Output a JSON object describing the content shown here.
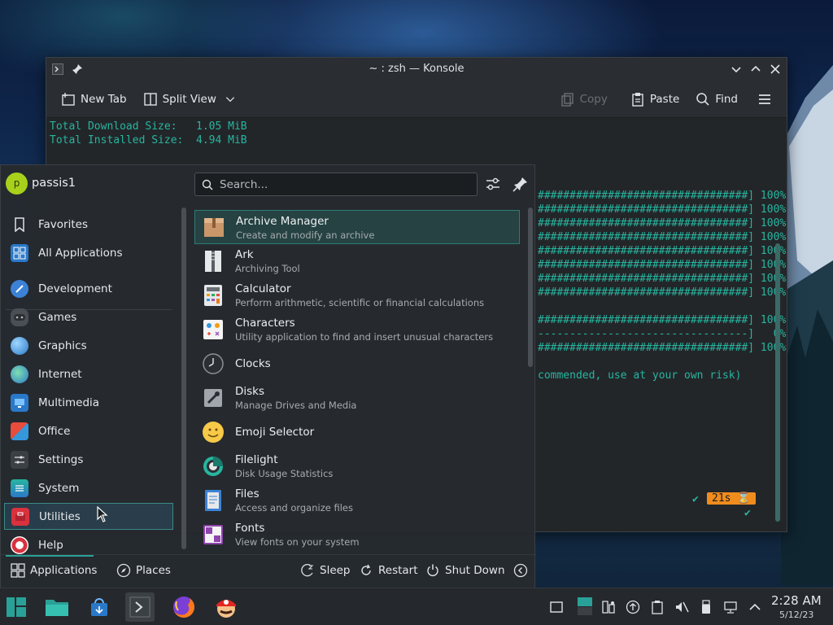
{
  "konsole": {
    "title": "~ : zsh — Konsole",
    "toolbar": {
      "new_tab": "New Tab",
      "split_view": "Split View",
      "copy": "Copy",
      "paste": "Paste",
      "find": "Find"
    },
    "terminal_lines": [
      "Total Download Size:   1.05 MiB",
      "Total Installed Size:  4.94 MiB",
      "#################################] 100%",
      "#################################] 100%",
      "#################################] 100%",
      "#################################] 100%",
      "#################################] 100%",
      "#################################] 100%",
      "#################################] 100%",
      "#################################] 100%",
      "#################################] 100%",
      "---------------------------------]   0%",
      "#################################] 100%",
      "commended, use at your own risk)"
    ],
    "prompt_status": "✔",
    "prompt_time": "21s ⌛",
    "prompt_check": "✔"
  },
  "launcher": {
    "user": {
      "initial": "p",
      "name": "passis1"
    },
    "search_placeholder": "Search...",
    "categories": [
      {
        "label": "Favorites",
        "icon": "bookmark-icon"
      },
      {
        "label": "All Applications",
        "icon": "grid-icon"
      },
      {
        "label": "Development",
        "icon": "development-icon"
      },
      {
        "label": "Games",
        "icon": "gamepad-icon"
      },
      {
        "label": "Graphics",
        "icon": "graphics-icon"
      },
      {
        "label": "Internet",
        "icon": "globe-icon"
      },
      {
        "label": "Multimedia",
        "icon": "multimedia-icon"
      },
      {
        "label": "Office",
        "icon": "office-icon"
      },
      {
        "label": "Settings",
        "icon": "settings-icon"
      },
      {
        "label": "System",
        "icon": "system-icon"
      },
      {
        "label": "Utilities",
        "icon": "utilities-icon"
      },
      {
        "label": "Help",
        "icon": "help-icon"
      }
    ],
    "apps": [
      {
        "title": "Archive Manager",
        "desc": "Create and modify an archive",
        "icon": "archive-icon"
      },
      {
        "title": "Ark",
        "desc": "Archiving Tool",
        "icon": "zipper-icon"
      },
      {
        "title": "Calculator",
        "desc": "Perform arithmetic, scientific or financial calculations",
        "icon": "calculator-icon"
      },
      {
        "title": "Characters",
        "desc": "Utility application to find and insert unusual characters",
        "icon": "characters-icon"
      },
      {
        "title": "Clocks",
        "desc": "",
        "icon": "clock-icon"
      },
      {
        "title": "Disks",
        "desc": "Manage Drives and Media",
        "icon": "disks-icon"
      },
      {
        "title": "Emoji Selector",
        "desc": "",
        "icon": "emoji-icon"
      },
      {
        "title": "Filelight",
        "desc": "Disk Usage Statistics",
        "icon": "filelight-icon"
      },
      {
        "title": "Files",
        "desc": "Access and organize files",
        "icon": "files-icon"
      },
      {
        "title": "Fonts",
        "desc": "View fonts on your system",
        "icon": "fonts-icon"
      }
    ],
    "footer": {
      "applications": "Applications",
      "places": "Places",
      "sleep": "Sleep",
      "restart": "Restart",
      "shutdown": "Shut Down"
    }
  },
  "taskbar": {
    "clock_time": "2:28 AM",
    "clock_date": "5/12/23"
  },
  "colors": {
    "accent": "#2aa198",
    "terminal_green": "#27b5a0",
    "prompt_badge": "#f08c1e"
  }
}
